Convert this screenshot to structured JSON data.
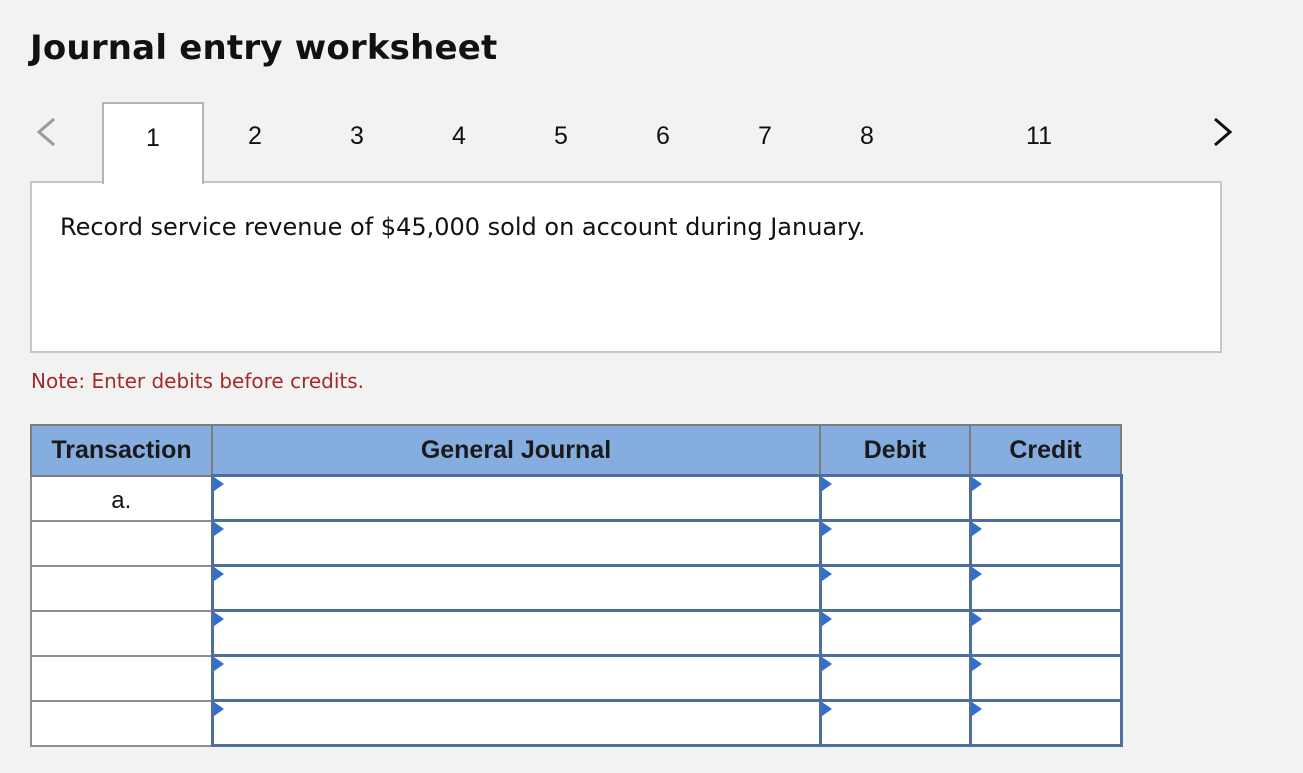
{
  "page": {
    "title": "Journal entry worksheet"
  },
  "tabs": [
    {
      "label": "1",
      "active": true
    },
    {
      "label": "2"
    },
    {
      "label": "3"
    },
    {
      "label": "4"
    },
    {
      "label": "5"
    },
    {
      "label": "6"
    },
    {
      "label": "7"
    },
    {
      "label": "8"
    },
    {
      "label": "11"
    }
  ],
  "instruction": {
    "text": "Record service revenue of $45,000 sold on account during January."
  },
  "note": {
    "text": "Note: Enter debits before credits."
  },
  "journal": {
    "headers": {
      "transaction": "Transaction",
      "general_journal": "General Journal",
      "debit": "Debit",
      "credit": "Credit"
    },
    "rows": [
      {
        "transaction": "a.",
        "account": "",
        "debit": "",
        "credit": ""
      },
      {
        "transaction": "",
        "account": "",
        "debit": "",
        "credit": ""
      },
      {
        "transaction": "",
        "account": "",
        "debit": "",
        "credit": ""
      },
      {
        "transaction": "",
        "account": "",
        "debit": "",
        "credit": ""
      },
      {
        "transaction": "",
        "account": "",
        "debit": "",
        "credit": ""
      },
      {
        "transaction": "",
        "account": "",
        "debit": "",
        "credit": ""
      }
    ]
  },
  "colors": {
    "header_bg": "#86ade0",
    "note_text": "#a52a2a",
    "input_border": "#4e6f9c",
    "marker": "#2f6fd0"
  },
  "icons": {
    "prev": "chevron-left-icon",
    "next": "chevron-right-icon"
  }
}
